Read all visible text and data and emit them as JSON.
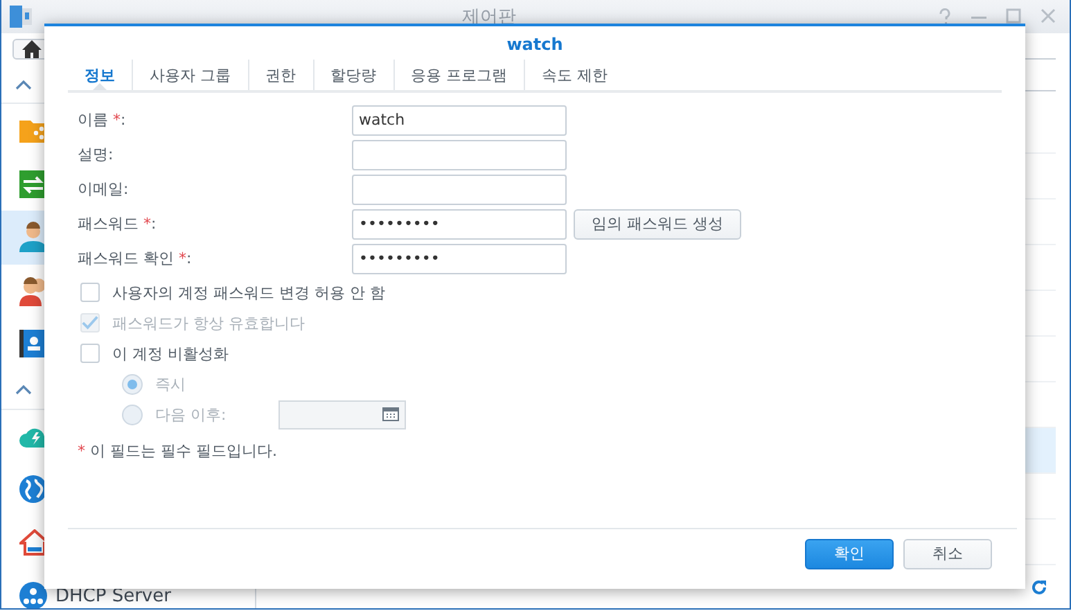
{
  "window": {
    "title": "제어판"
  },
  "sidebar": {
    "groups": [
      {
        "items": [
          {
            "kind": "folder",
            "selected": false
          },
          {
            "kind": "transfer",
            "selected": false
          },
          {
            "kind": "user",
            "selected": true
          },
          {
            "kind": "group",
            "selected": false
          },
          {
            "kind": "directory",
            "selected": false
          }
        ]
      },
      {
        "items": [
          {
            "kind": "cloud",
            "selected": false
          },
          {
            "kind": "globe",
            "selected": false
          },
          {
            "kind": "house",
            "selected": false
          },
          {
            "kind": "dhcp",
            "selected": false,
            "label": "DHCP Server"
          }
        ]
      }
    ]
  },
  "dialog": {
    "title": "watch",
    "tabs": [
      {
        "label": "정보",
        "selected": true
      },
      {
        "label": "사용자 그룹",
        "selected": false
      },
      {
        "label": "권한",
        "selected": false
      },
      {
        "label": "할당량",
        "selected": false
      },
      {
        "label": "응용 프로그램",
        "selected": false
      },
      {
        "label": "속도 제한",
        "selected": false
      }
    ],
    "fields": [
      {
        "label": "이름",
        "mark": "*",
        "tail": ":",
        "value": "watch"
      },
      {
        "label": "설명",
        "tail": ":"
      },
      {
        "label": "이메일",
        "tail": ":"
      },
      {
        "label": "패스워드",
        "mark": "*",
        "tail": ":",
        "value": "•••••••••",
        "button": "임의 패스워드 생성"
      },
      {
        "label": "패스워드 확인",
        "mark": "*",
        "tail": ":",
        "value": "•••••••••"
      }
    ],
    "checkboxes": [
      {
        "label": "사용자의 계정 패스워드 변경 허용 안 함",
        "checked": false,
        "disabled": false
      },
      {
        "label": "패스워드가 항상 유효합니다",
        "checked": true,
        "disabled": true
      },
      {
        "label": "이 계정 비활성화",
        "checked": false,
        "disabled": false
      }
    ],
    "radios": [
      {
        "kind": "plain",
        "label": "즉시",
        "selected": true,
        "disabled": true
      },
      {
        "kind": "date",
        "label": "다음 이후:",
        "selected": false,
        "disabled": true
      }
    ],
    "note": {
      "mark": "*",
      "text": "이 필드는 필수 필드입니다."
    },
    "buttons": [
      {
        "label": "확인",
        "kind": "primary"
      },
      {
        "label": "취소",
        "kind": "secondary"
      }
    ]
  }
}
